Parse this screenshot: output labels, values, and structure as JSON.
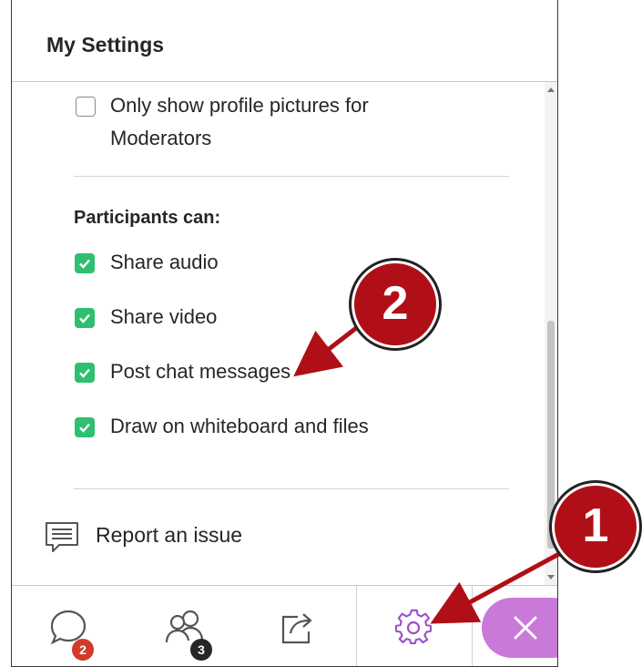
{
  "panel": {
    "title": "My Settings"
  },
  "profile_option": {
    "label_line1": "Only show profile pictures for",
    "label_line2": "Moderators",
    "checked": false
  },
  "participants": {
    "heading": "Participants can:",
    "options": [
      {
        "label": "Share audio",
        "checked": true
      },
      {
        "label": "Share video",
        "checked": true
      },
      {
        "label": "Post chat messages",
        "checked": true
      },
      {
        "label": "Draw on whiteboard and files",
        "checked": true
      }
    ]
  },
  "report": {
    "label": "Report an issue"
  },
  "footer": {
    "chat_badge": "2",
    "attendees_badge": "3"
  },
  "callouts": {
    "one": "1",
    "two": "2"
  },
  "colors": {
    "checkbox_checked": "#2fbf71",
    "settings_icon": "#9b4fc7",
    "leave_button": "#c97ad8",
    "callout": "#b10f17",
    "chat_badge": "#d23a2a",
    "attendees_badge": "#262626"
  }
}
